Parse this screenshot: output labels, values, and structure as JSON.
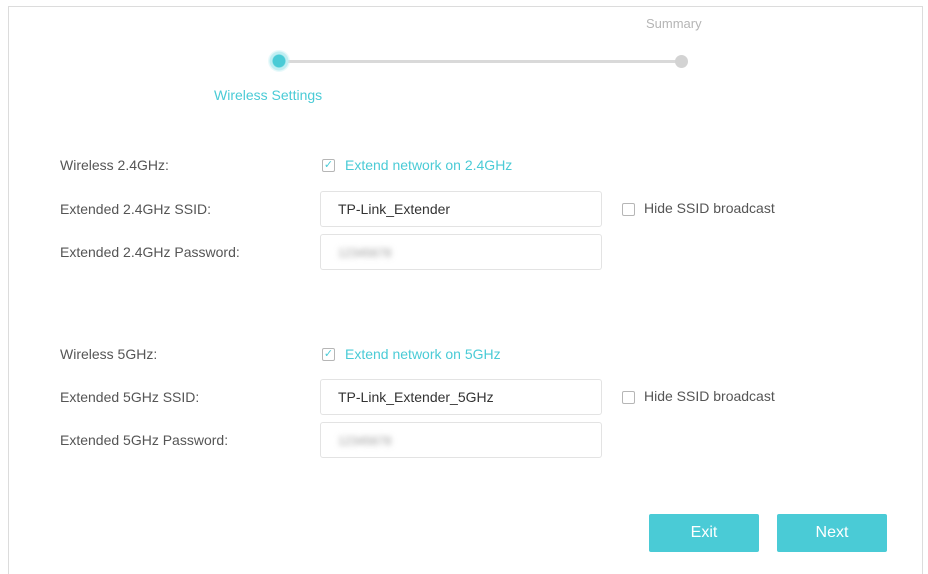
{
  "stepper": {
    "steps": [
      {
        "label": "Wireless Settings",
        "state": "active"
      },
      {
        "label": "Summary",
        "state": "inactive"
      }
    ]
  },
  "band_24": {
    "wireless_label": "Wireless 2.4GHz:",
    "extend_label": "Extend network on 2.4GHz",
    "extend_checked": true,
    "ssid_label": "Extended 2.4GHz SSID:",
    "ssid_value": "TP-Link_Extender",
    "hide_ssid_label": "Hide SSID broadcast",
    "hide_ssid_checked": false,
    "password_label": "Extended 2.4GHz Password:",
    "password_value": "12345678"
  },
  "band_5": {
    "wireless_label": "Wireless 5GHz:",
    "extend_label": "Extend network on 5GHz",
    "extend_checked": true,
    "ssid_label": "Extended 5GHz SSID:",
    "ssid_value": "TP-Link_Extender_5GHz",
    "hide_ssid_label": "Hide SSID broadcast",
    "hide_ssid_checked": false,
    "password_label": "Extended 5GHz Password:",
    "password_value": "12345678"
  },
  "buttons": {
    "exit_label": "Exit",
    "next_label": "Next"
  },
  "colors": {
    "accent": "#4acbd6",
    "label_text": "#555555",
    "inactive": "#d3d3d3"
  }
}
